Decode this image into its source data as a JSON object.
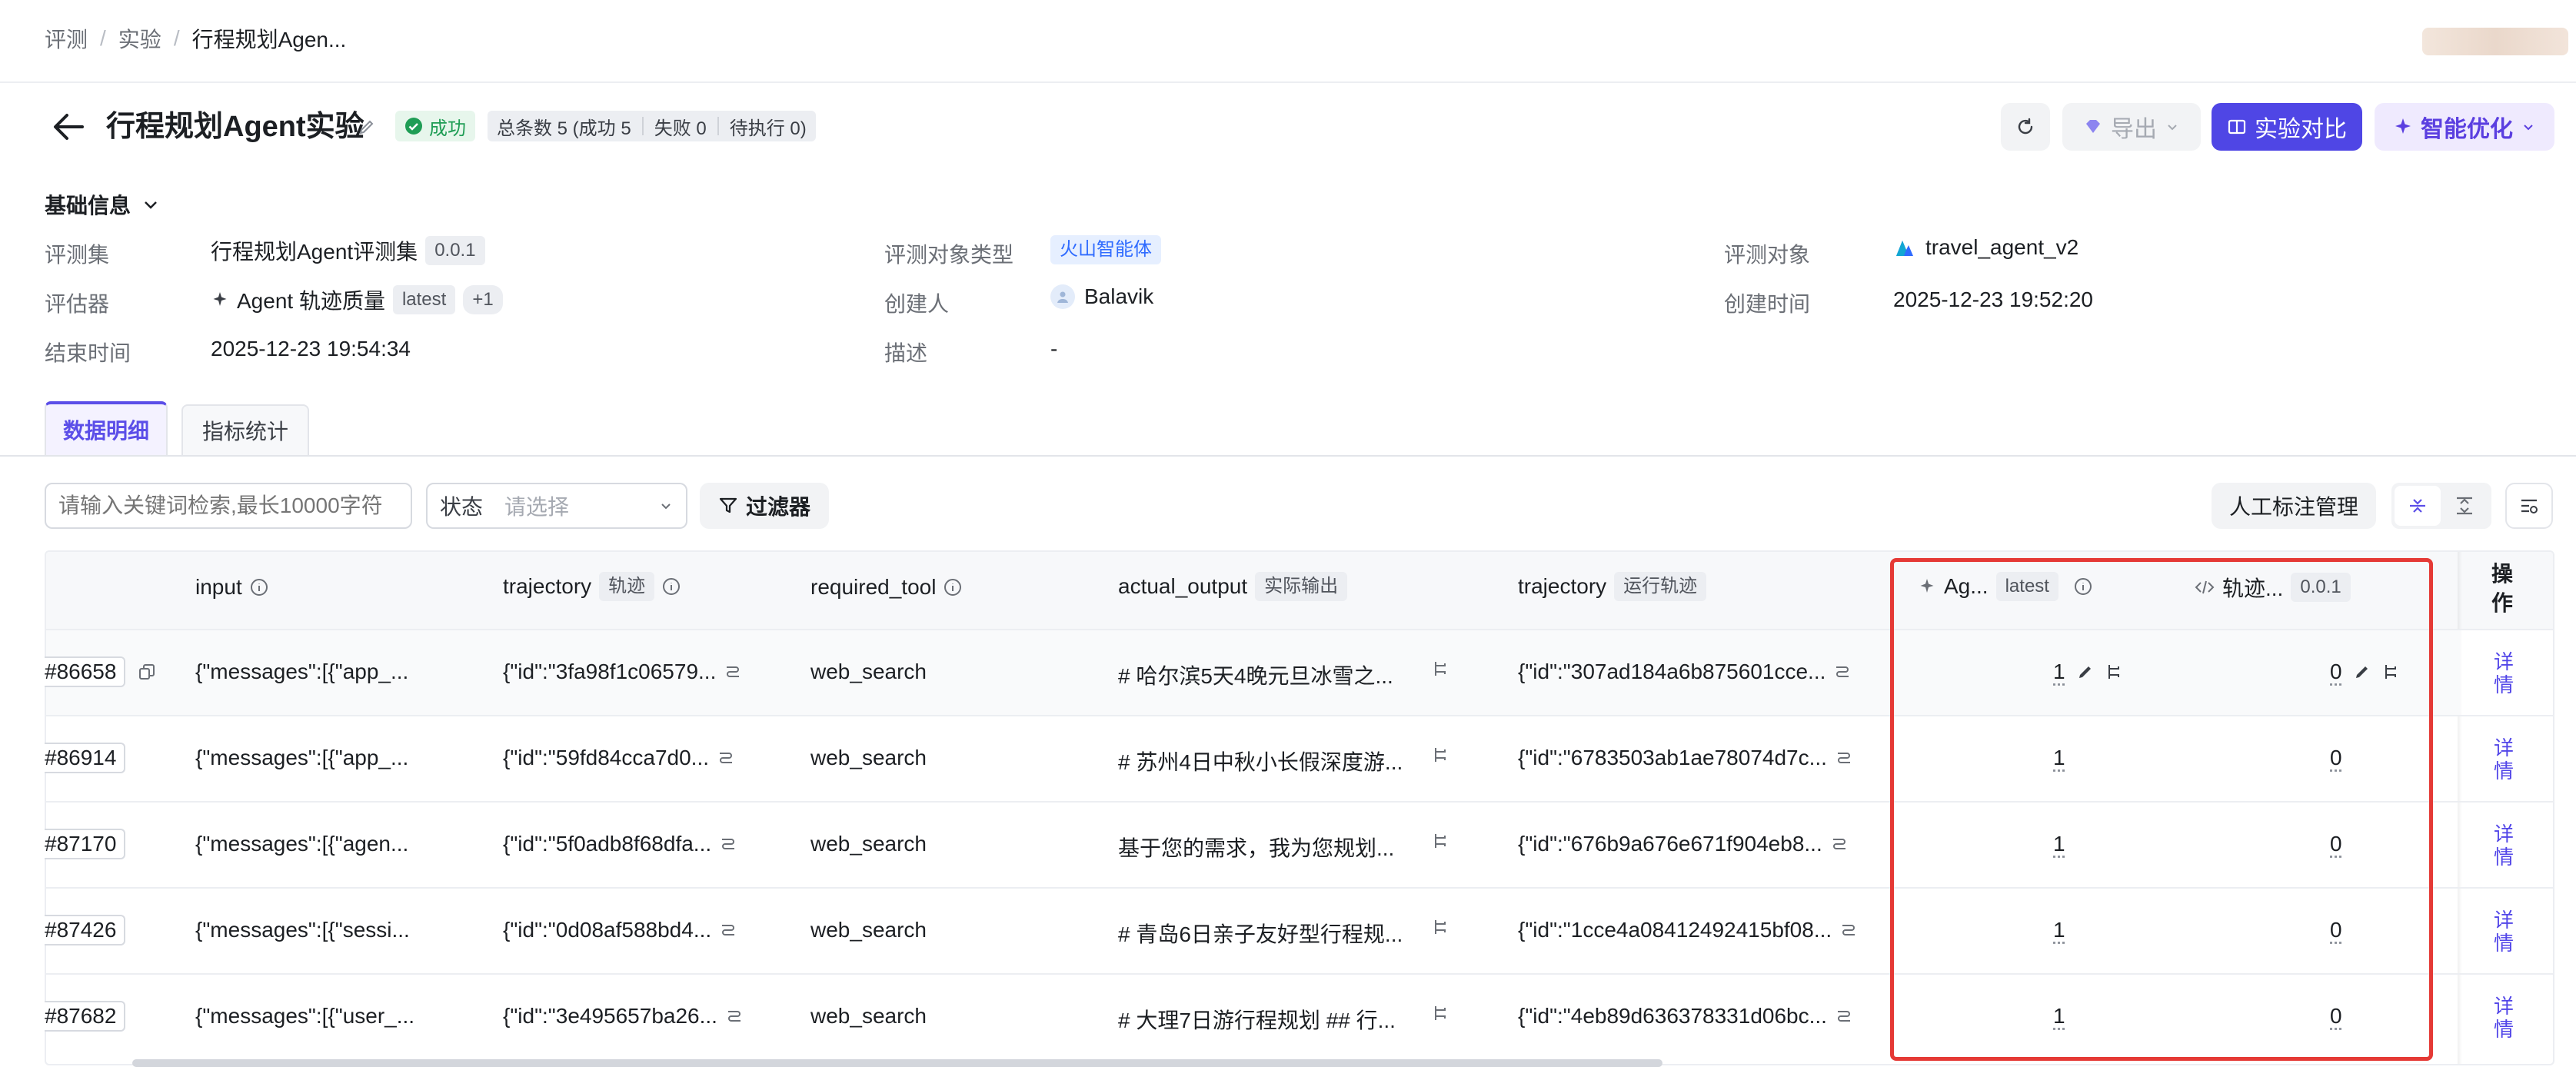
{
  "breadcrumb": [
    "评测",
    "实验",
    "行程规划Agen..."
  ],
  "header": {
    "title": "行程规划Agent实验",
    "status": "成功",
    "summary": {
      "total": "总条数 5 (成功 5",
      "failed": "失败 0",
      "pending": "待执行 0)"
    },
    "export_label": "导出",
    "compare_label": "实验对比",
    "optimize_label": "智能优化"
  },
  "basic_info": {
    "section_title": "基础信息",
    "dataset_label": "评测集",
    "dataset_value": "行程规划Agent评测集",
    "dataset_version": "0.0.1",
    "evaluator_label": "评估器",
    "evaluator_value": "Agent 轨迹质量",
    "evaluator_version": "latest",
    "evaluator_more": "+1",
    "end_time_label": "结束时间",
    "end_time_value": "2025-12-23 19:54:34",
    "target_type_label": "评测对象类型",
    "target_type_value": "火山智能体",
    "creator_label": "创建人",
    "creator_value": "Balavik",
    "desc_label": "描述",
    "desc_value": "-",
    "target_label": "评测对象",
    "target_value": "travel_agent_v2",
    "created_label": "创建时间",
    "created_value": "2025-12-23 19:52:20"
  },
  "tabs": [
    "数据明细",
    "指标统计"
  ],
  "toolbar": {
    "search_placeholder": "请输入关键词检索,最长10000字符",
    "status_label": "状态",
    "status_placeholder": "请选择",
    "filter_label": "过滤器",
    "manual_label": "人工标注管理"
  },
  "table": {
    "headers": {
      "input": "input",
      "trajectory": "trajectory",
      "trajectory_tag": "轨迹",
      "required_tool": "required_tool",
      "actual_output": "actual_output",
      "actual_output_tag": "实际输出",
      "trajectory2": "trajectory",
      "trajectory2_tag": "运行轨迹",
      "agent_eval": "Ag...",
      "agent_eval_tag": "latest",
      "traj_eval": "轨迹...",
      "traj_eval_tag": "0.0.1",
      "ops": "操作"
    },
    "rows": [
      {
        "id": "#86658",
        "input": "{\"messages\":[{\"app_...",
        "trajectory": "{\"id\":\"3fa98f1c06579...",
        "required_tool": "web_search",
        "actual_output": "# 哈尔滨5天4晚元旦冰雪之...",
        "trajectory2": "{\"id\":\"307ad184a6b875601cce...",
        "agent_score": "1",
        "traj_score": "0",
        "detail": "详情"
      },
      {
        "id": "#86914",
        "input": "{\"messages\":[{\"app_...",
        "trajectory": "{\"id\":\"59fd84cca7d0...",
        "required_tool": "web_search",
        "actual_output": "# 苏州4日中秋小长假深度游...",
        "trajectory2": "{\"id\":\"6783503ab1ae78074d7c...",
        "agent_score": "1",
        "traj_score": "0",
        "detail": "详情"
      },
      {
        "id": "#87170",
        "input": "{\"messages\":[{\"agen...",
        "trajectory": "{\"id\":\"5f0adb8f68dfa...",
        "required_tool": "web_search",
        "actual_output": "基于您的需求，我为您规划...",
        "trajectory2": "{\"id\":\"676b9a676e671f904eb8...",
        "agent_score": "1",
        "traj_score": "0",
        "detail": "详情"
      },
      {
        "id": "#87426",
        "input": "{\"messages\":[{\"sessi...",
        "trajectory": "{\"id\":\"0d08af588bd4...",
        "required_tool": "web_search",
        "actual_output": "# 青岛6日亲子友好型行程规...",
        "trajectory2": "{\"id\":\"1cce4a08412492415bf08...",
        "agent_score": "1",
        "traj_score": "0",
        "detail": "详情"
      },
      {
        "id": "#87682",
        "input": "{\"messages\":[{\"user_...",
        "trajectory": "{\"id\":\"3e495657ba26...",
        "required_tool": "web_search",
        "actual_output": "# 大理7日游行程规划 ## 行...",
        "trajectory2": "{\"id\":\"4eb89d636378331d06bc...",
        "agent_score": "1",
        "traj_score": "0",
        "detail": "详情"
      }
    ]
  },
  "colors": {
    "accent": "#4f46e5",
    "success": "#1f9d55",
    "highlight_border": "#e53935"
  }
}
